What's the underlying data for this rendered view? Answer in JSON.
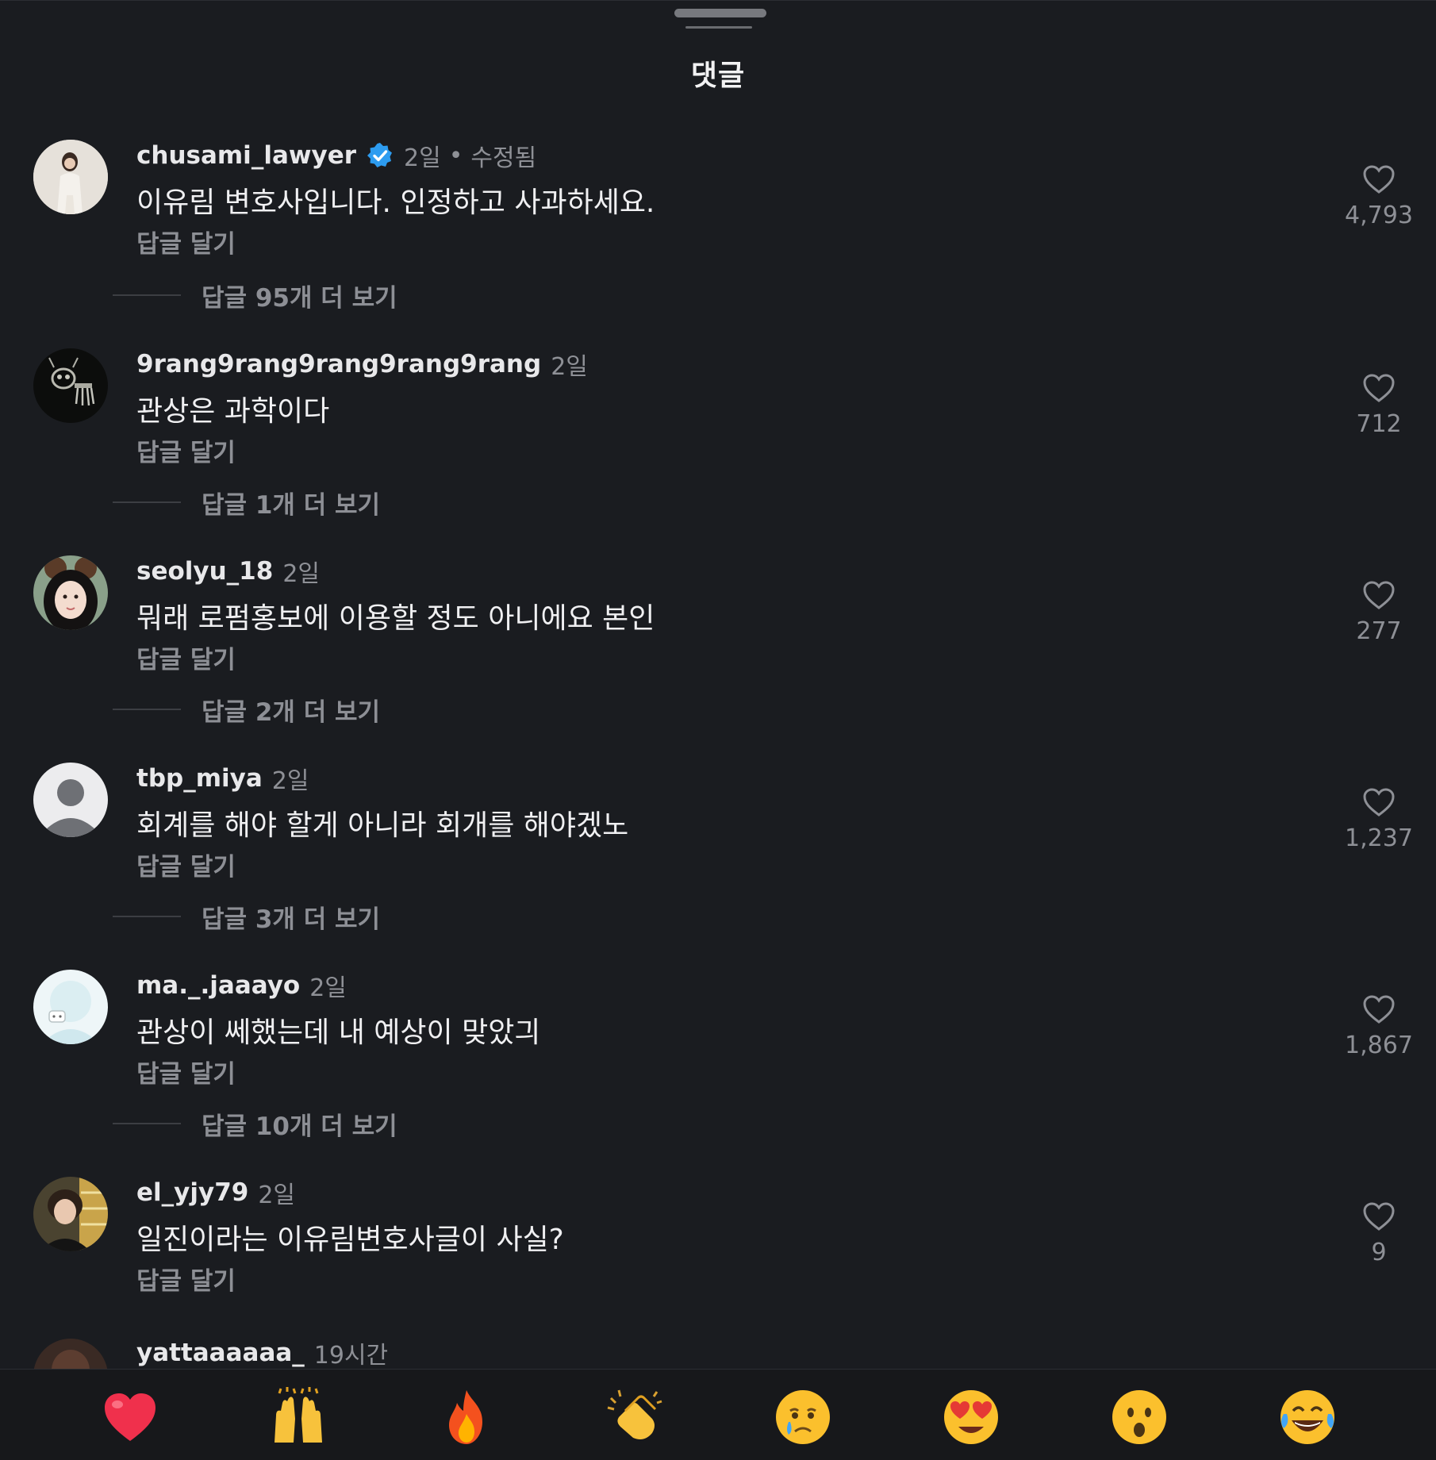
{
  "sheet": {
    "title": "댓글"
  },
  "comments": [
    {
      "username": "chusami_lawyer",
      "verified": true,
      "time": "2일",
      "edited": "수정됨",
      "text": "이유림 변호사입니다. 인정하고 사과하세요.",
      "reply": "답글 달기",
      "likes": "4,793",
      "more_replies": "답글 95개 더 보기"
    },
    {
      "username": "9rang9rang9rang9rang9rang",
      "time": "2일",
      "text": "관상은 과학이다",
      "reply": "답글 달기",
      "likes": "712",
      "more_replies": "답글 1개 더 보기"
    },
    {
      "username": "seolyu_18",
      "time": "2일",
      "text": "뭐래 로펌홍보에 이용할 정도 아니에요 본인",
      "reply": "답글 달기",
      "likes": "277",
      "more_replies": "답글 2개 더 보기"
    },
    {
      "username": "tbp_miya",
      "time": "2일",
      "text": "회계를 해야 할게 아니라 회개를 해야겠노",
      "reply": "답글 달기",
      "likes": "1,237",
      "more_replies": "답글 3개 더 보기"
    },
    {
      "username": "ma._.jaaayo",
      "time": "2일",
      "text": "관상이 쎄했는데 내 예상이 맞았긔",
      "reply": "답글 달기",
      "likes": "1,867",
      "more_replies": "답글 10개 더 보기"
    },
    {
      "username": "el_yjy79",
      "time": "2일",
      "text": "일진이라는 이유림변호사글이 사실?",
      "reply": "답글 달기",
      "likes": "9"
    },
    {
      "username": "yattaaaaaa_",
      "time": "19시간"
    }
  ],
  "emoji_bar": [
    {
      "icon": "red-heart-emoji"
    },
    {
      "icon": "raising-hands-emoji"
    },
    {
      "icon": "fire-emoji"
    },
    {
      "icon": "clapping-hands-emoji"
    },
    {
      "icon": "crying-face-emoji"
    },
    {
      "icon": "heart-eyes-emoji"
    },
    {
      "icon": "surprised-face-emoji"
    },
    {
      "icon": "tears-of-joy-emoji"
    }
  ],
  "colors": {
    "background": "#1a1c20",
    "text_primary": "#f0f0f2",
    "text_secondary": "#8e9096",
    "verified_blue": "#2d9cf0"
  }
}
